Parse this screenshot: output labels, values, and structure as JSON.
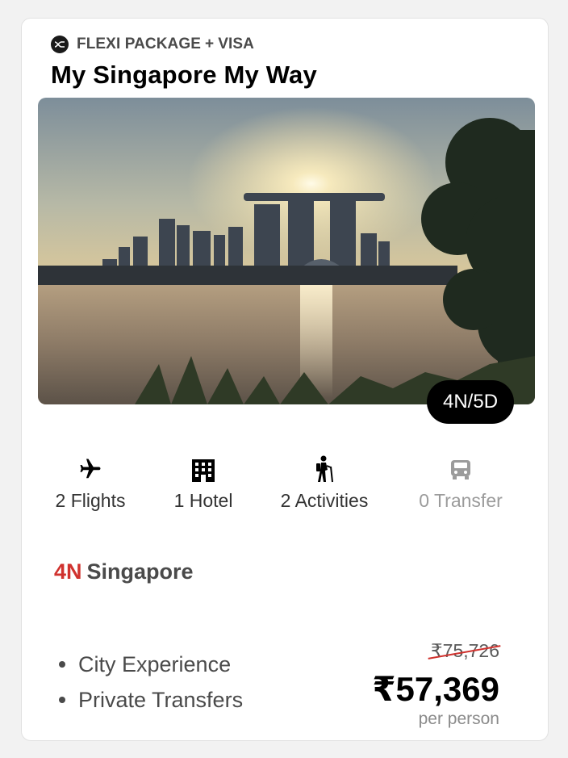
{
  "package": {
    "type_label": "FLEXI PACKAGE",
    "plus": "+",
    "visa_label": "VISA",
    "type_icon": "flexi-shuffle-icon",
    "title": "My Singapore My Way",
    "image_alt": "Singapore skyline at sunset",
    "duration": "4N/5D"
  },
  "features": [
    {
      "icon": "airplane-icon",
      "label": "2 Flights",
      "enabled": true
    },
    {
      "icon": "hotel-building-icon",
      "label": "1 Hotel",
      "enabled": true
    },
    {
      "icon": "hiker-icon",
      "label": "2 Activities",
      "enabled": true
    },
    {
      "icon": "car-icon",
      "label": "0 Transfer",
      "enabled": false
    }
  ],
  "destination": {
    "nights": "4N",
    "city": "Singapore"
  },
  "highlights": [
    "City Experience",
    "Private Transfers"
  ],
  "pricing": {
    "original": "₹75,726",
    "current": "₹57,369",
    "unit": "per person"
  },
  "colors": {
    "accent_red": "#d0322e",
    "text_dark": "#4a4a4a",
    "muted": "#9b9b9b"
  }
}
